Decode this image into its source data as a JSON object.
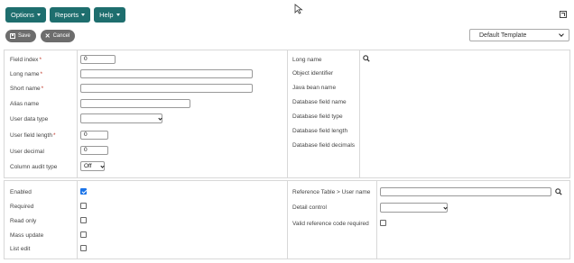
{
  "menubar": {
    "items": [
      {
        "label": "Options"
      },
      {
        "label": "Reports"
      },
      {
        "label": "Help"
      }
    ]
  },
  "actions": {
    "save_label": "Save",
    "cancel_label": "Cancel"
  },
  "template_select": {
    "value": "Default Template"
  },
  "left_fields": {
    "field_index": {
      "label": "Field index",
      "value": "0"
    },
    "long_name": {
      "label": "Long name",
      "value": ""
    },
    "short_name": {
      "label": "Short name",
      "value": ""
    },
    "alias_name": {
      "label": "Alias name",
      "value": ""
    },
    "user_data_type": {
      "label": "User data type",
      "value": ""
    },
    "user_field_length": {
      "label": "User field length",
      "value": "0"
    },
    "user_decimal": {
      "label": "User decimal",
      "value": "0"
    },
    "column_audit_type": {
      "label": "Column audit type",
      "value": "Off"
    }
  },
  "right_info": {
    "long_name": "Long name",
    "object_identifier": "Object identifier",
    "java_bean_name": "Java bean name",
    "database_field_name": "Database field name",
    "database_field_type": "Database field type",
    "database_field_length": "Database field length",
    "database_field_decimals": "Database field decimals"
  },
  "flags": {
    "enabled": {
      "label": "Enabled",
      "checked": true
    },
    "required": {
      "label": "Required",
      "checked": false
    },
    "read_only": {
      "label": "Read only",
      "checked": false
    },
    "mass_update": {
      "label": "Mass update",
      "checked": false
    },
    "list_edit": {
      "label": "List edit",
      "checked": false
    }
  },
  "reference": {
    "reference_table_label": "Reference Table > User name",
    "reference_table_value": "",
    "detail_control_label": "Detail control",
    "detail_control_value": "",
    "valid_ref_label": "Valid reference code required",
    "valid_ref_checked": false
  },
  "colors": {
    "menu_bg": "#1e6e6e",
    "pill_bg": "#6d6d6d",
    "required_marker": "#c0392b",
    "checkbox_checked": "#1a73e8"
  }
}
